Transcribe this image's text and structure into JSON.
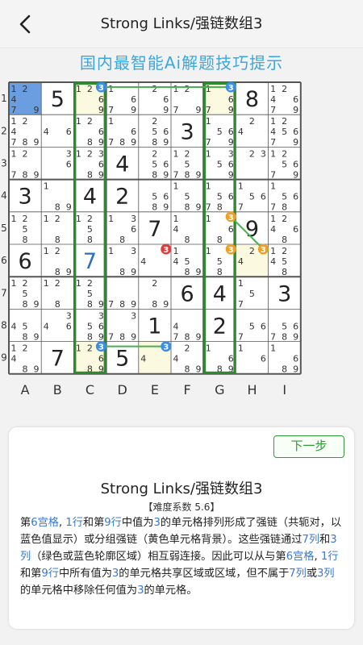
{
  "header": {
    "title": "Strong Links/强链数组3",
    "back_icon": "chevron-left-icon"
  },
  "banner": {
    "text": "国内最智能Ai解题技巧提示"
  },
  "board": {
    "row_labels": [
      "1",
      "2",
      "3",
      "4",
      "5",
      "6",
      "7",
      "8",
      "9"
    ],
    "col_labels": [
      "A",
      "B",
      "C",
      "D",
      "E",
      "F",
      "G",
      "H",
      "I"
    ],
    "cells": [
      [
        {
          "v": null,
          "c": [
            1,
            2,
            4,
            7,
            9
          ],
          "bg": "#6a9ee0"
        },
        {
          "v": "5"
        },
        {
          "v": null,
          "c": [
            1,
            2,
            3,
            6,
            9
          ],
          "bg": "#fbf9df"
        },
        {
          "v": null,
          "c": [
            1,
            6,
            7,
            9
          ]
        },
        {
          "v": null,
          "c": [
            2,
            6,
            9
          ]
        },
        {
          "v": null,
          "c": [
            1,
            2,
            7,
            9
          ]
        },
        {
          "v": null,
          "c": [
            1,
            3,
            6,
            7,
            9
          ],
          "bg": "#fbf9df"
        },
        {
          "v": "8"
        },
        {
          "v": null,
          "c": [
            1,
            2,
            4,
            6,
            7,
            9
          ]
        }
      ],
      [
        {
          "v": null,
          "c": [
            1,
            2,
            4,
            7,
            8,
            9
          ]
        },
        {
          "v": null,
          "c": [
            4,
            6
          ]
        },
        {
          "v": null,
          "c": [
            1,
            2,
            6,
            8,
            9
          ]
        },
        {
          "v": null,
          "c": [
            1,
            6,
            7,
            8,
            9
          ]
        },
        {
          "v": null,
          "c": [
            2,
            5,
            6,
            8,
            9
          ]
        },
        {
          "v": "3"
        },
        {
          "v": null,
          "c": [
            1,
            5,
            6,
            7,
            9
          ]
        },
        {
          "v": null,
          "c": [
            2,
            4
          ]
        },
        {
          "v": null,
          "c": [
            1,
            2,
            4,
            5,
            6,
            7,
            9
          ]
        }
      ],
      [
        {
          "v": null,
          "c": [
            1,
            2,
            7,
            8,
            9
          ]
        },
        {
          "v": null,
          "c": [
            3,
            6
          ]
        },
        {
          "v": null,
          "c": [
            1,
            2,
            3,
            6,
            8,
            9
          ]
        },
        {
          "v": "4"
        },
        {
          "v": null,
          "c": [
            2,
            5,
            6,
            8,
            9
          ]
        },
        {
          "v": null,
          "c": [
            1,
            2,
            5,
            7,
            8,
            9
          ]
        },
        {
          "v": null,
          "c": [
            1,
            3,
            5,
            6,
            9
          ]
        },
        {
          "v": null,
          "c": [
            2,
            3
          ]
        },
        {
          "v": null,
          "c": [
            1,
            2,
            5,
            6,
            7,
            9
          ]
        }
      ],
      [
        {
          "v": "3"
        },
        {
          "v": null,
          "c": [
            1,
            8,
            9
          ]
        },
        {
          "v": "4"
        },
        {
          "v": "2"
        },
        {
          "v": null,
          "c": [
            5,
            6,
            8,
            9
          ]
        },
        {
          "v": null,
          "c": [
            1,
            5,
            8,
            9
          ]
        },
        {
          "v": null,
          "c": [
            1,
            5,
            6,
            7,
            8
          ]
        },
        {
          "v": null,
          "c": [
            1,
            5,
            6,
            7
          ]
        },
        {
          "v": null,
          "c": [
            1,
            5,
            6,
            7,
            8
          ]
        }
      ],
      [
        {
          "v": null,
          "c": [
            1,
            2,
            5,
            8
          ]
        },
        {
          "v": null,
          "c": [
            1,
            2,
            8
          ]
        },
        {
          "v": null,
          "c": [
            1,
            2,
            5,
            8
          ]
        },
        {
          "v": null,
          "c": [
            1,
            3,
            6,
            8
          ]
        },
        {
          "v": "7"
        },
        {
          "v": null,
          "c": [
            1,
            4,
            8
          ]
        },
        {
          "v": null,
          "c": [
            1,
            3,
            6,
            8
          ]
        },
        {
          "v": "9"
        },
        {
          "v": null,
          "c": [
            1,
            2,
            4,
            6,
            8
          ]
        }
      ],
      [
        {
          "v": "6"
        },
        {
          "v": null,
          "c": [
            1,
            2,
            8,
            9
          ]
        },
        {
          "v": "7",
          "blue": true
        },
        {
          "v": null,
          "c": [
            1,
            3,
            8,
            9
          ]
        },
        {
          "v": null,
          "c": [
            3,
            4
          ]
        },
        {
          "v": null,
          "c": [
            1,
            4,
            5,
            8,
            9
          ]
        },
        {
          "v": null,
          "c": [
            1,
            3,
            5,
            8
          ]
        },
        {
          "v": null,
          "c": [
            2,
            3,
            4
          ],
          "bg": "#fbf9df"
        },
        {
          "v": null,
          "c": [
            1,
            2,
            4,
            5,
            8
          ]
        }
      ],
      [
        {
          "v": null,
          "c": [
            1,
            2,
            5,
            8,
            9
          ]
        },
        {
          "v": null,
          "c": [
            1,
            2,
            8
          ]
        },
        {
          "v": null,
          "c": [
            1,
            2,
            5,
            8,
            9
          ]
        },
        {
          "v": null,
          "c": [
            7,
            8,
            9
          ]
        },
        {
          "v": null,
          "c": [
            2,
            8,
            9
          ]
        },
        {
          "v": "6"
        },
        {
          "v": "4"
        },
        {
          "v": null,
          "c": [
            1,
            5,
            7
          ]
        },
        {
          "v": "3"
        }
      ],
      [
        {
          "v": null,
          "c": [
            4,
            5,
            8,
            9
          ]
        },
        {
          "v": null,
          "c": [
            3,
            4,
            6
          ]
        },
        {
          "v": null,
          "c": [
            3,
            5,
            6,
            8,
            9
          ]
        },
        {
          "v": null,
          "c": [
            3,
            7,
            8,
            9
          ]
        },
        {
          "v": "1"
        },
        {
          "v": null,
          "c": [
            4,
            7,
            8,
            9
          ]
        },
        {
          "v": "2"
        },
        {
          "v": null,
          "c": [
            5,
            6,
            7
          ]
        },
        {
          "v": null,
          "c": [
            5,
            6,
            7,
            8,
            9
          ]
        }
      ],
      [
        {
          "v": null,
          "c": [
            1,
            2,
            4,
            8,
            9
          ]
        },
        {
          "v": "7"
        },
        {
          "v": null,
          "c": [
            1,
            2,
            3,
            6,
            8,
            9
          ],
          "bg": "#fbf9df"
        },
        {
          "v": "5"
        },
        {
          "v": null,
          "c": [
            3,
            4
          ],
          "bg": "#fbf9df"
        },
        {
          "v": null,
          "c": [
            2,
            4,
            8,
            9
          ]
        },
        {
          "v": null,
          "c": [
            1,
            6,
            8,
            9
          ]
        },
        {
          "v": null,
          "c": [
            1,
            6
          ]
        },
        {
          "v": null,
          "c": [
            1,
            6,
            8,
            9
          ]
        }
      ]
    ],
    "colors": {
      "given_digit": "#222222",
      "placed_digit": "#2d6fc2",
      "candidate": "#333333",
      "highlight_blue": "#6a9ee0",
      "highlight_yellow": "#fbf9df",
      "link_green": "#2e8a2e",
      "marker_blue": "#3a8ee6",
      "marker_orange": "#f0a020",
      "marker_red": "#e23b3b"
    },
    "markers": [
      {
        "row": 0,
        "col": 2,
        "digit": "3",
        "color": "blue"
      },
      {
        "row": 0,
        "col": 6,
        "digit": "3",
        "color": "blue"
      },
      {
        "row": 8,
        "col": 2,
        "digit": "3",
        "color": "blue"
      },
      {
        "row": 8,
        "col": 4,
        "digit": "3",
        "color": "blue"
      },
      {
        "row": 4,
        "col": 6,
        "digit": "3",
        "color": "orange"
      },
      {
        "row": 5,
        "col": 6,
        "digit": "3",
        "color": "orange"
      },
      {
        "row": 5,
        "col": 7,
        "digit": "3",
        "color": "orange"
      },
      {
        "row": 5,
        "col": 4,
        "digit": "3",
        "color": "red"
      }
    ],
    "links": [
      {
        "from": [
          0,
          2
        ],
        "to": [
          0,
          6
        ],
        "color": "green"
      },
      {
        "from": [
          8,
          2
        ],
        "to": [
          8,
          4
        ],
        "color": "green"
      },
      {
        "from": [
          4,
          6
        ],
        "to": [
          5,
          7
        ],
        "color": "green"
      }
    ]
  },
  "hint_card": {
    "next_button": "下一步",
    "title": "Strong Links/强链数组3",
    "difficulty": "【难度系数 5.6】",
    "description_parts": [
      {
        "t": "第"
      },
      {
        "t": "6宫格",
        "h": true
      },
      {
        "t": ", "
      },
      {
        "t": "1行",
        "h": true
      },
      {
        "t": "和第"
      },
      {
        "t": "9行",
        "h": true
      },
      {
        "t": "中值为"
      },
      {
        "t": "3",
        "h": true
      },
      {
        "t": "的单元格排列形成了强链（共轭对，以蓝色值显示）或分组强链（黄色单元格背景）。这些强链通过"
      },
      {
        "t": "7列",
        "h": true
      },
      {
        "t": "和"
      },
      {
        "t": "3列",
        "h": true
      },
      {
        "t": "（绿色或蓝色轮廓区域）相互弱连接。因此可以从与第"
      },
      {
        "t": "6宫格",
        "h": true
      },
      {
        "t": ", "
      },
      {
        "t": "1行",
        "h": true
      },
      {
        "t": "和第"
      },
      {
        "t": "9行",
        "h": true
      },
      {
        "t": "中所有值为"
      },
      {
        "t": "3",
        "h": true
      },
      {
        "t": "的单元格共享区域或区域，但不属于"
      },
      {
        "t": "7列",
        "h": true
      },
      {
        "t": "或"
      },
      {
        "t": "3列",
        "h": true
      },
      {
        "t": "的单元格中移除任何值为"
      },
      {
        "t": "3",
        "h": true
      },
      {
        "t": "的单元格。"
      }
    ]
  }
}
